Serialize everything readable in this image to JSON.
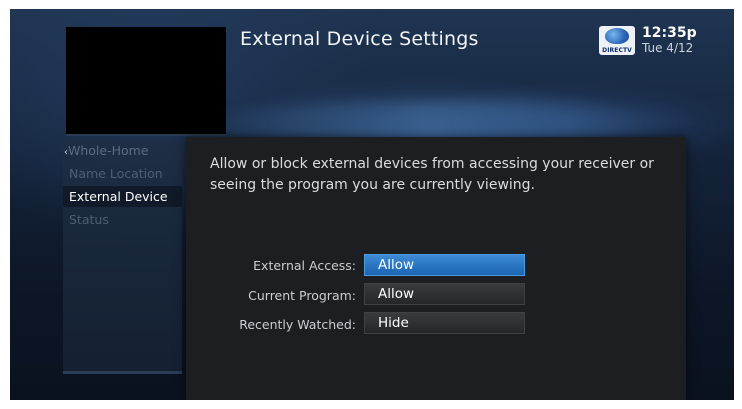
{
  "header": {
    "title": "External Device Settings",
    "logo_text": "DIRECTV",
    "time": "12:35p",
    "date": "Tue 4/12"
  },
  "sidebar": {
    "items": [
      {
        "label": "Whole-Home",
        "back_chevron": "‹"
      },
      {
        "label": "Name Location"
      },
      {
        "label": "External Device"
      },
      {
        "label": "Status"
      }
    ]
  },
  "panel": {
    "description": "Allow or block external devices from accessing your receiver or seeing the program you are currently viewing.",
    "settings": [
      {
        "label": "External Access:",
        "value": "Allow"
      },
      {
        "label": "Current Program:",
        "value": "Allow"
      },
      {
        "label": "Recently Watched:",
        "value": "Hide"
      }
    ]
  },
  "colors": {
    "accent": "#1b64b1",
    "background": "#14233a",
    "panel": "#1d1e21"
  },
  "icons": [
    "directv-logo-icon",
    "chevron-left-icon"
  ]
}
